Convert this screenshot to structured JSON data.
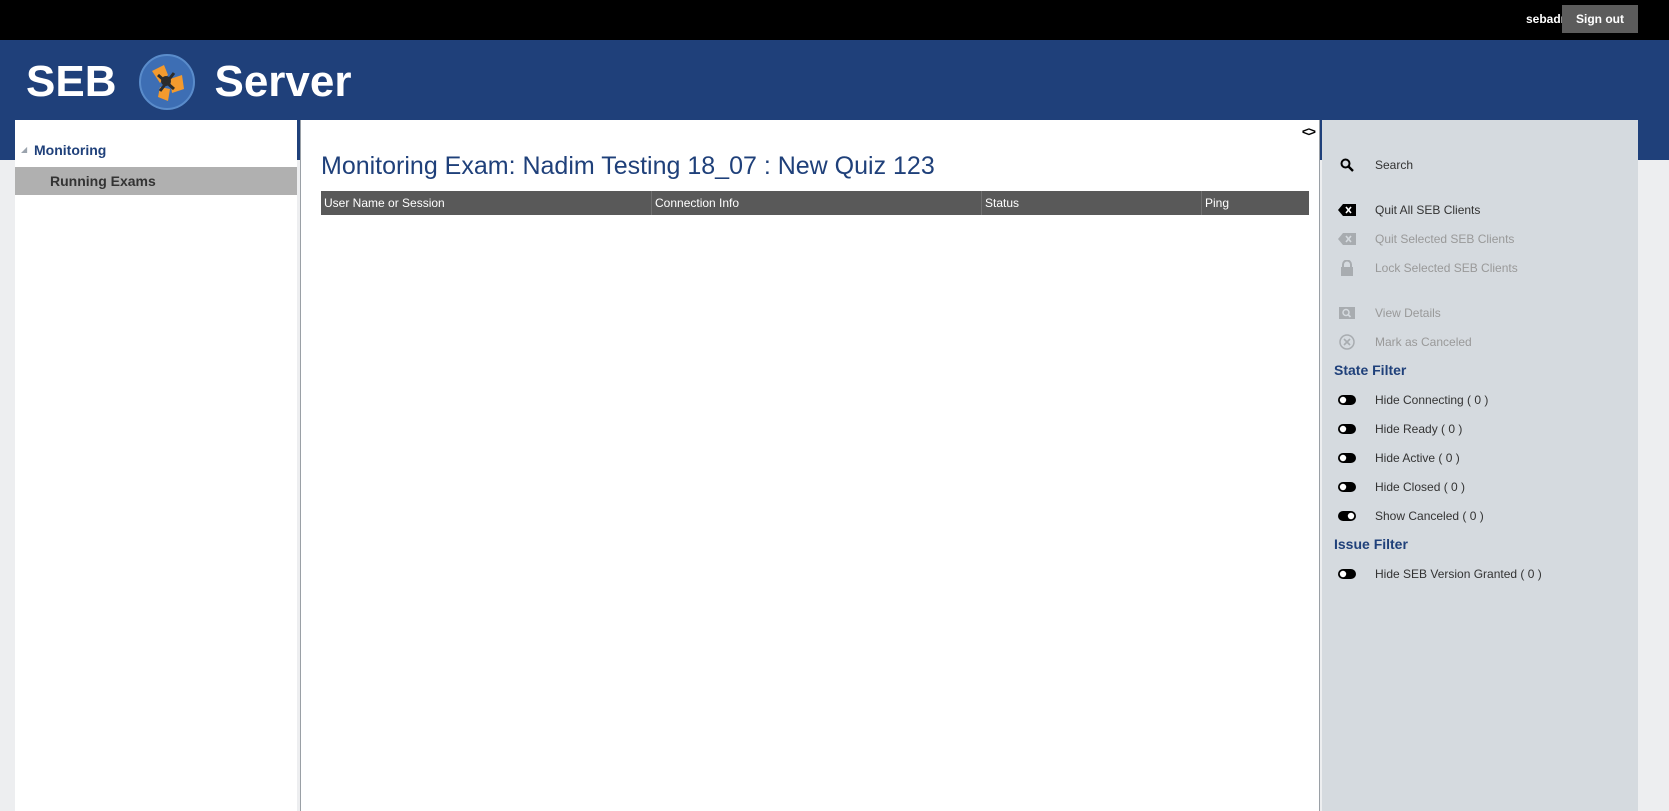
{
  "user": {
    "name": "sebadmin",
    "signout_label": "Sign out"
  },
  "logo": {
    "left_word": "SEB",
    "right_word": "Server"
  },
  "nav": {
    "group_label": "Monitoring",
    "items": [
      {
        "label": "Running Exams"
      }
    ]
  },
  "main": {
    "title": "Monitoring Exam: Nadim Testing 18_07 : New Quiz 123",
    "columns": [
      "User Name or Session",
      "Connection Info",
      "Status",
      "Ping"
    ]
  },
  "sidebar": {
    "search_label": "Search",
    "actions": [
      {
        "label": "Quit All SEB Clients",
        "icon": "quit-icon",
        "enabled": true
      },
      {
        "label": "Quit Selected SEB Clients",
        "icon": "quit-icon",
        "enabled": false
      },
      {
        "label": "Lock Selected SEB Clients",
        "icon": "lock-icon",
        "enabled": false
      }
    ],
    "detail_actions": [
      {
        "label": "View Details",
        "icon": "view-details-icon",
        "enabled": false
      },
      {
        "label": "Mark as Canceled",
        "icon": "cancel-icon",
        "enabled": false
      }
    ],
    "state_filter": {
      "title": "State Filter",
      "items": [
        {
          "label": "Hide Connecting ( 0 )",
          "on": false
        },
        {
          "label": "Hide Ready ( 0 )",
          "on": false
        },
        {
          "label": "Hide Active ( 0 )",
          "on": false
        },
        {
          "label": "Hide Closed ( 0 )",
          "on": false
        },
        {
          "label": "Show Canceled ( 0 )",
          "on": true
        }
      ]
    },
    "issue_filter": {
      "title": "Issue Filter",
      "items": [
        {
          "label": "Hide SEB Version Granted ( 0 )",
          "on": false
        }
      ]
    }
  },
  "colors": {
    "brand": "#1f407a",
    "topbar": "#000000",
    "table_header": "#595959",
    "sidebar_bg": "#d5dadf",
    "nav_selected": "#b0b0b0"
  }
}
